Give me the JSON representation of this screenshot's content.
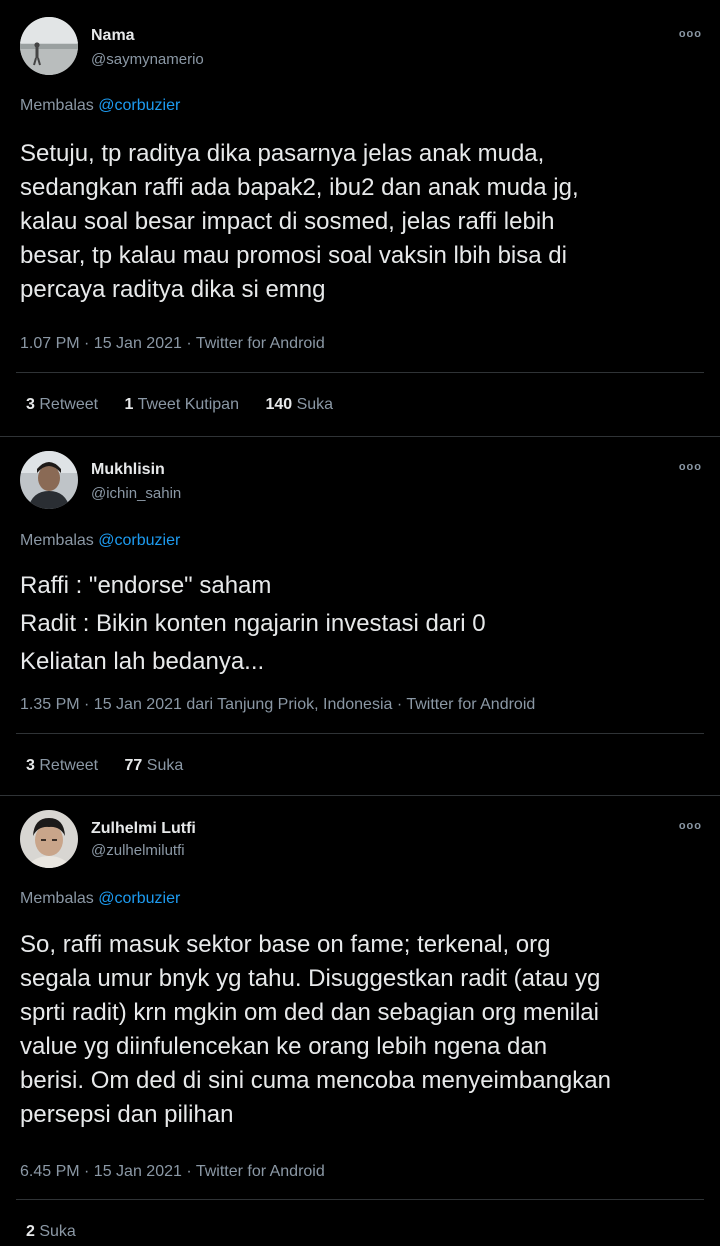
{
  "tweets": [
    {
      "name": "Nama",
      "handle": "@saymynamerio",
      "more": "ooo",
      "reply_prefix": "Membalas",
      "reply_to": "@corbuzier",
      "body": [
        "Setuju, tp raditya dika pasarnya jelas anak muda,",
        "sedangkan raffi ada bapak2, ibu2 dan anak muda jg,",
        "kalau soal besar impact di sosmed, jelas raffi lebih",
        "besar, tp kalau mau promosi soal vaksin lbih bisa di",
        "percaya raditya dika si emng"
      ],
      "meta": "1.07 PM · 15 Jan 2021 · Twitter for Android",
      "stats": [
        {
          "count": "3",
          "label": "Retweet"
        },
        {
          "count": "1",
          "label": "Tweet Kutipan"
        },
        {
          "count": "140",
          "label": "Suka"
        }
      ]
    },
    {
      "name": "Mukhlisin",
      "handle": "@ichin_sahin",
      "more": "ooo",
      "reply_prefix": "Membalas",
      "reply_to": "@corbuzier",
      "body": [
        "Raffi : \"endorse\" saham",
        "Radit : Bikin konten ngajarin investasi dari 0",
        "Keliatan lah bedanya..."
      ],
      "meta": "1.35 PM · 15 Jan 2021 dari Tanjung Priok, Indonesia · Twitter for Android",
      "stats": [
        {
          "count": "3",
          "label": "Retweet"
        },
        {
          "count": "77",
          "label": "Suka"
        }
      ]
    },
    {
      "name": "Zulhelmi Lutfi",
      "handle": "@zulhelmilutfi",
      "more": "ooo",
      "reply_prefix": "Membalas",
      "reply_to": "@corbuzier",
      "body": [
        "So, raffi masuk sektor base on fame; terkenal, org",
        "segala umur bnyk yg tahu. Disuggestkan radit (atau yg",
        "sprti radit) krn mgkin om ded dan sebagian org menilai",
        "value yg diinfulencekan ke orang lebih ngena dan",
        "berisi. Om ded di sini cuma mencoba menyeimbangkan",
        "persepsi dan pilihan"
      ],
      "meta": "6.45 PM · 15 Jan 2021 · Twitter for Android",
      "stats": [
        {
          "count": "2",
          "label": "Suka"
        }
      ]
    }
  ]
}
